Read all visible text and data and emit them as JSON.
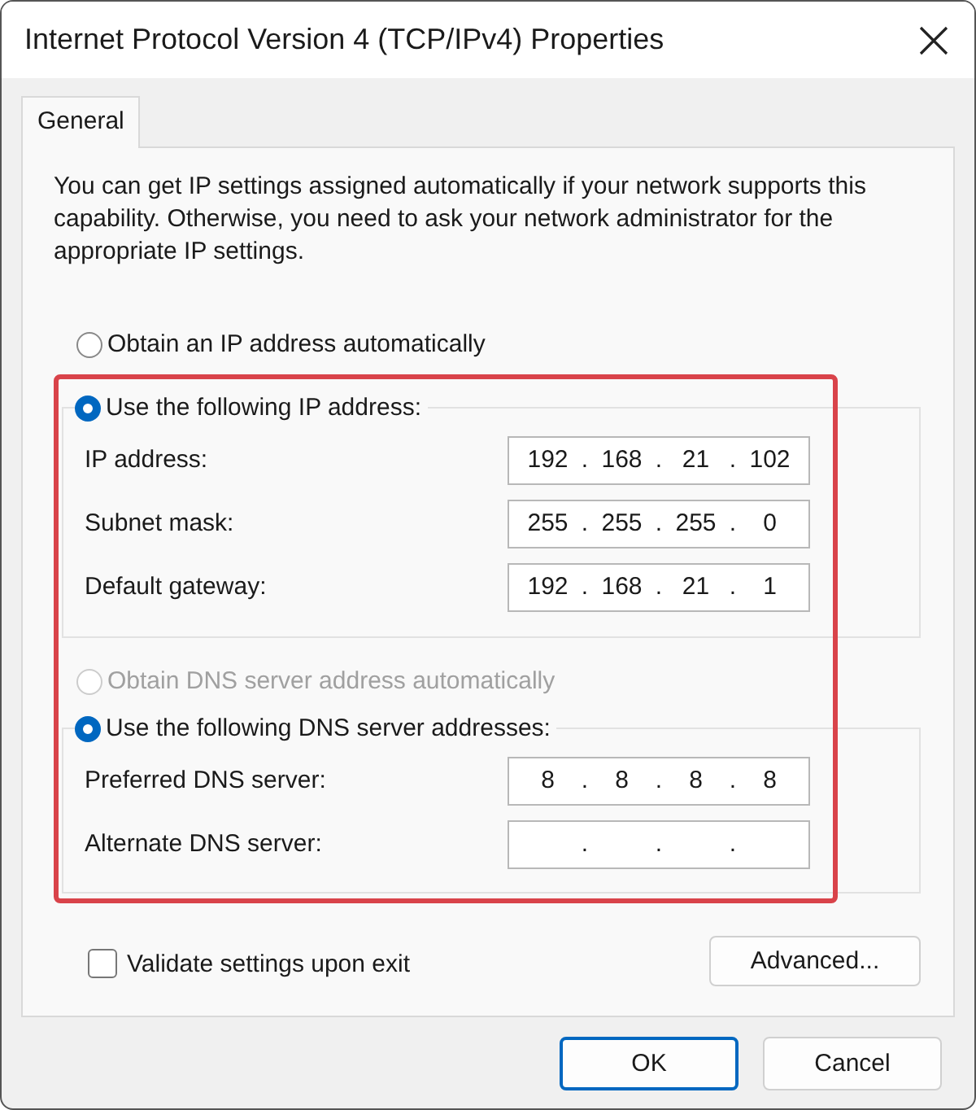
{
  "window": {
    "title": "Internet Protocol Version 4 (TCP/IPv4) Properties"
  },
  "tabs": [
    {
      "label": "General",
      "selected": true
    }
  ],
  "description": "You can get IP settings assigned automatically if your network supports this capability. Otherwise, you need to ask your network administrator for the appropriate IP settings.",
  "ip_auto": {
    "label": "Obtain an IP address automatically",
    "selected": false,
    "disabled": false
  },
  "ip_manual": {
    "label": "Use the following IP address:",
    "selected": true,
    "disabled": false,
    "fields": [
      {
        "label": "IP address:",
        "separator": ".",
        "octets": [
          "192",
          "168",
          "21",
          "102"
        ]
      },
      {
        "label": "Subnet mask:",
        "separator": ".",
        "octets": [
          "255",
          "255",
          "255",
          "0"
        ]
      },
      {
        "label": "Default gateway:",
        "separator": ".",
        "octets": [
          "192",
          "168",
          "21",
          "1"
        ]
      }
    ]
  },
  "dns_auto": {
    "label": "Obtain DNS server address automatically",
    "selected": false,
    "disabled": true
  },
  "dns_manual": {
    "label": "Use the following DNS server addresses:",
    "selected": true,
    "disabled": false,
    "fields": [
      {
        "label": "Preferred DNS server:",
        "separator": ".",
        "octets": [
          "8",
          "8",
          "8",
          "8"
        ]
      },
      {
        "label": "Alternate DNS server:",
        "separator": "."
      }
    ]
  },
  "validate": {
    "label": "Validate settings upon exit",
    "checked": false
  },
  "advanced_button": "Advanced...",
  "buttons": [
    {
      "label": "OK",
      "default": true
    },
    {
      "label": "Cancel",
      "default": false
    }
  ]
}
